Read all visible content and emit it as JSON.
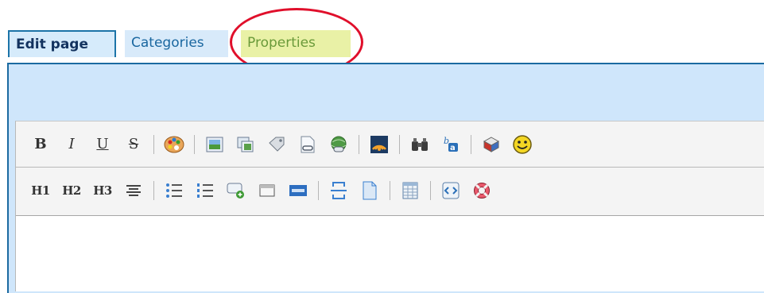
{
  "tabs": {
    "edit_page": "Edit page",
    "categories": "Categories",
    "properties": "Properties"
  },
  "toolbar": {
    "row1": {
      "bold": "B",
      "italic": "I",
      "underline": "U",
      "strikethrough": "S"
    },
    "row2": {
      "h1": "H1",
      "h2": "H2",
      "h3": "H3"
    }
  },
  "colors": {
    "tab_border": "#1c74a8",
    "panel_bg": "#cfe6fb",
    "properties_bg": "#e9f1a6",
    "highlight_ring": "#e00f2b"
  }
}
